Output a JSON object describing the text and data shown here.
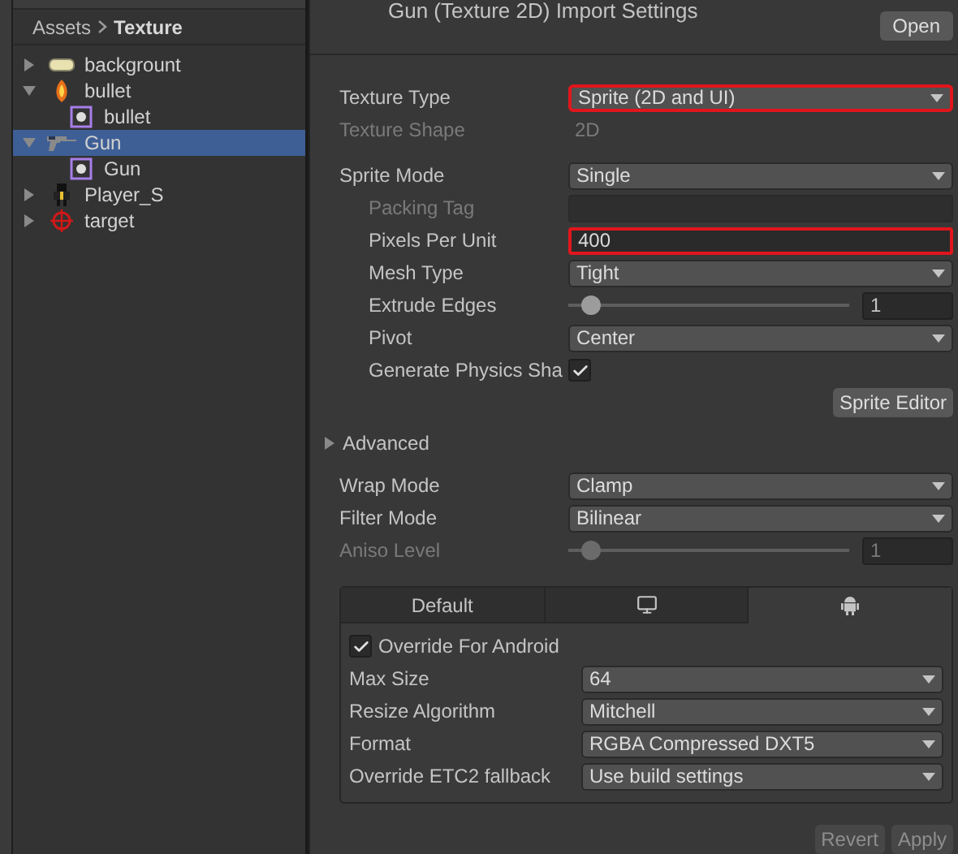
{
  "breadcrumb": {
    "root": "Assets",
    "current": "Texture"
  },
  "tree": [
    {
      "label": "backgrount",
      "kind": "background",
      "expanded": false,
      "selected": false
    },
    {
      "label": "bullet",
      "kind": "flame",
      "expanded": true,
      "selected": false,
      "children": [
        {
          "label": "bullet",
          "kind": "sprite",
          "selected": false
        }
      ]
    },
    {
      "label": "Gun",
      "kind": "gun",
      "expanded": true,
      "selected": true,
      "children": [
        {
          "label": "Gun",
          "kind": "sprite",
          "selected": false
        }
      ]
    },
    {
      "label": "Player_S",
      "kind": "player",
      "expanded": false,
      "selected": false
    },
    {
      "label": "target",
      "kind": "target",
      "expanded": false,
      "selected": false
    }
  ],
  "inspector": {
    "title": "Gun (Texture 2D) Import Settings",
    "open_button": "Open",
    "rows": [
      {
        "kind": "dropdown",
        "label": "Texture Type",
        "value": "Sprite (2D and UI)",
        "disabled": false,
        "highlighted": true
      },
      {
        "kind": "text",
        "label": "Texture Shape",
        "value": "2D",
        "disabled": true
      },
      {
        "kind": "dropdown",
        "label": "Sprite Mode",
        "value": "Single",
        "disabled": false,
        "highlighted": false,
        "children": [
          {
            "kind": "field",
            "label": "Packing Tag",
            "disabled": true,
            "highlighted": false
          },
          {
            "kind": "field",
            "label": "Pixels Per Unit",
            "value": "400",
            "disabled": false,
            "highlighted": true
          },
          {
            "kind": "dropdown",
            "label": "Mesh Type",
            "value": "Tight",
            "disabled": false,
            "highlighted": false
          },
          {
            "kind": "slider",
            "label": "Extrude Edges",
            "value": "1",
            "level": 0.08,
            "disabled": false
          },
          {
            "kind": "dropdown",
            "label": "Pivot",
            "value": "Center",
            "disabled": false,
            "highlighted": false
          },
          {
            "kind": "checkbox",
            "label": "Generate Physics Sha",
            "checked": true,
            "disabled": false
          }
        ]
      }
    ],
    "sprite_editor_button": "Sprite Editor",
    "advanced": {
      "label": "Advanced",
      "expanded": false
    },
    "rows2": [
      {
        "kind": "dropdown",
        "label": "Wrap Mode",
        "value": "Clamp",
        "disabled": false,
        "highlighted": false
      },
      {
        "kind": "dropdown",
        "label": "Filter Mode",
        "value": "Bilinear",
        "disabled": false,
        "highlighted": false
      },
      {
        "kind": "slider",
        "label": "Aniso Level",
        "value": "1",
        "level": 0.08,
        "disabled": true
      }
    ],
    "platform_tabs": [
      {
        "kind": "text",
        "label": "Default",
        "selected": false
      },
      {
        "kind": "monitor",
        "selected": false
      },
      {
        "kind": "android",
        "selected": true
      }
    ],
    "override": {
      "label": "Override For Android",
      "checked": true
    },
    "platform_rows": [
      {
        "kind": "dropdown",
        "label": "Max Size",
        "value": "64",
        "disabled": false,
        "highlighted": false
      },
      {
        "kind": "dropdown",
        "label": "Resize Algorithm",
        "value": "Mitchell",
        "disabled": false,
        "highlighted": false
      },
      {
        "kind": "dropdown",
        "label": "Format",
        "value": "RGBA Compressed DXT5",
        "disabled": false,
        "highlighted": false
      },
      {
        "kind": "dropdown",
        "label": "Override ETC2 fallback",
        "value": "Use build settings",
        "disabled": false,
        "highlighted": false
      }
    ],
    "footer_buttons": [
      {
        "label": "Revert",
        "disabled": true
      },
      {
        "label": "Apply",
        "disabled": true
      }
    ]
  }
}
